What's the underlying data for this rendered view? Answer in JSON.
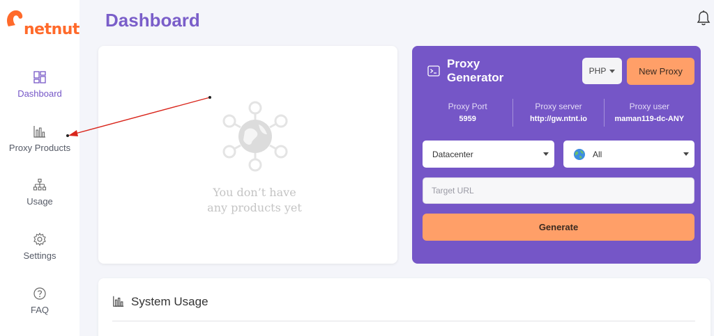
{
  "brand": {
    "name": "netnut",
    "color": "#ff6a2b"
  },
  "sidebar": {
    "items": [
      {
        "label": "Dashboard",
        "icon": "dashboard-grid-icon",
        "active": true
      },
      {
        "label": "Proxy Products",
        "icon": "bar-chart-icon",
        "active": false
      },
      {
        "label": "Usage",
        "icon": "sitemap-icon",
        "active": false
      },
      {
        "label": "Settings",
        "icon": "gear-icon",
        "active": false
      },
      {
        "label": "FAQ",
        "icon": "question-circle-icon",
        "active": false
      }
    ]
  },
  "header": {
    "title": "Dashboard",
    "notification_icon": "bell-icon"
  },
  "products": {
    "empty_line1": "You don’t have",
    "empty_line2": "any products yet"
  },
  "generator": {
    "title_line1": "Proxy",
    "title_line2": "Generator",
    "language_select": "PHP",
    "new_proxy_label": "New Proxy",
    "port_label": "Proxy Port",
    "port_value": "5959",
    "server_label": "Proxy server",
    "server_value": "http://gw.ntnt.io",
    "user_label": "Proxy user",
    "user_value": "maman119-dc-ANY",
    "type_select": "Datacenter",
    "country_select": "All",
    "target_placeholder": "Target URL",
    "generate_label": "Generate"
  },
  "usage": {
    "title": "System Usage"
  },
  "colors": {
    "accent": "#7556c7",
    "button": "#ff9f68",
    "annotation_arrow": "#d9261c"
  }
}
